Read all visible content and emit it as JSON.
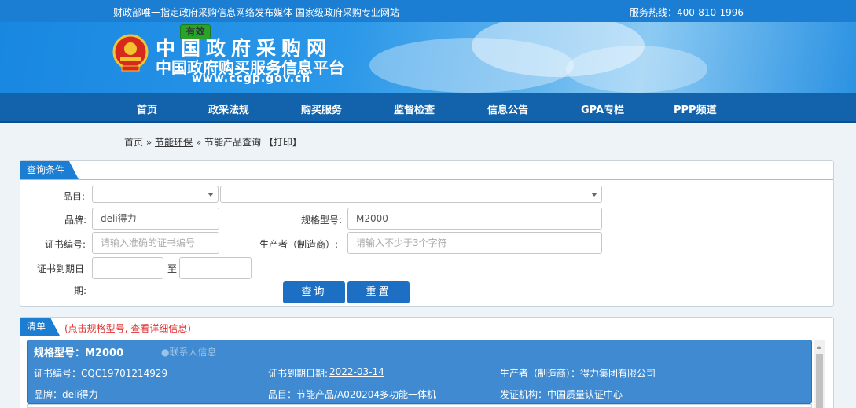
{
  "topbar": {
    "left_text": "财政部唯一指定政府采购信息网络发布媒体 国家级政府采购专业网站",
    "hotline": "服务热线：400-810-1996"
  },
  "logo": {
    "line1": "中国政府采购网",
    "line2": "中国政府购买服务信息平台",
    "url": "www.ccgp.gov.cn"
  },
  "nav": [
    "首页",
    "政采法规",
    "购买服务",
    "监督检查",
    "信息公告",
    "GPA专栏",
    "PPP频道"
  ],
  "breadcrumb": {
    "home": "首页",
    "sep1": "»",
    "section": "节能环保",
    "sep2": "»",
    "current": "节能产品查询",
    "print": "【打印】"
  },
  "query_panel": {
    "title": "查询条件",
    "category_label": "品目:",
    "category_value_1": "",
    "category_value_2": "",
    "brand_label": "品牌:",
    "brand_value": "deli得力",
    "model_label": "规格型号:",
    "model_value": "M2000",
    "cert_no_label": "证书编号:",
    "cert_no_placeholder": "请输入准确的证书编号",
    "maker_label": "生产者（制造商）:",
    "maker_placeholder": "请输入不少于3个字符",
    "expire_label_1": "证书到期日",
    "expire_label_2": "期:",
    "to_label": "至",
    "search_button": "查询",
    "reset_button": "重置"
  },
  "list_panel": {
    "title": "清单",
    "hint": "(点击规格型号, 查看详细信息)"
  },
  "result": {
    "model_title": "规格型号：M2000",
    "contact": "联系人信息",
    "cert_no": "证书编号：CQC19701214929",
    "status": "有效",
    "expire_label": "证书到期日期:",
    "expire_date": "2022-03-14",
    "maker": "生产者（制造商）：得力集团有限公司",
    "brand": "品牌：deli得力",
    "category": "品目：节能产品/A020204多功能一体机",
    "issuer": "发证机构：中国质量认证中心"
  }
}
